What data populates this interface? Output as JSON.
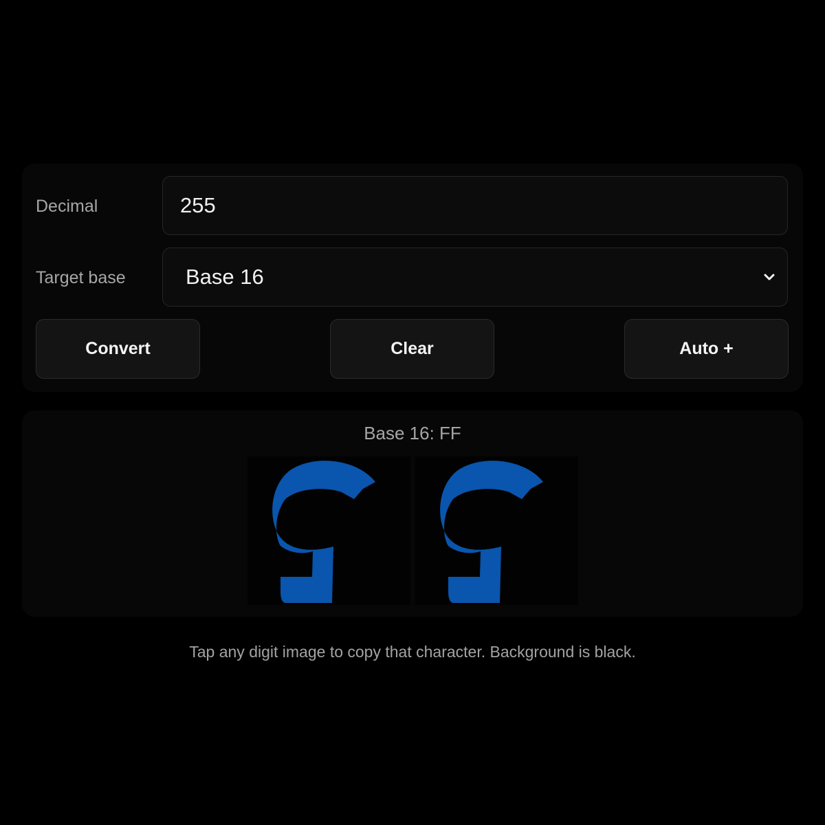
{
  "form": {
    "decimal_label": "Decimal",
    "decimal_value": "255",
    "base_label": "Target base",
    "base_selected": "Base 16"
  },
  "buttons": {
    "convert": "Convert",
    "clear": "Clear",
    "auto": "Auto +"
  },
  "result": {
    "text": "Base 16: FF",
    "digits": [
      "F",
      "F"
    ],
    "digit_color": "#0a55ad"
  },
  "hint": "Tap any digit image to copy that character. Background is black.",
  "icons": {
    "select_arrow": "chevron-down-icon"
  }
}
